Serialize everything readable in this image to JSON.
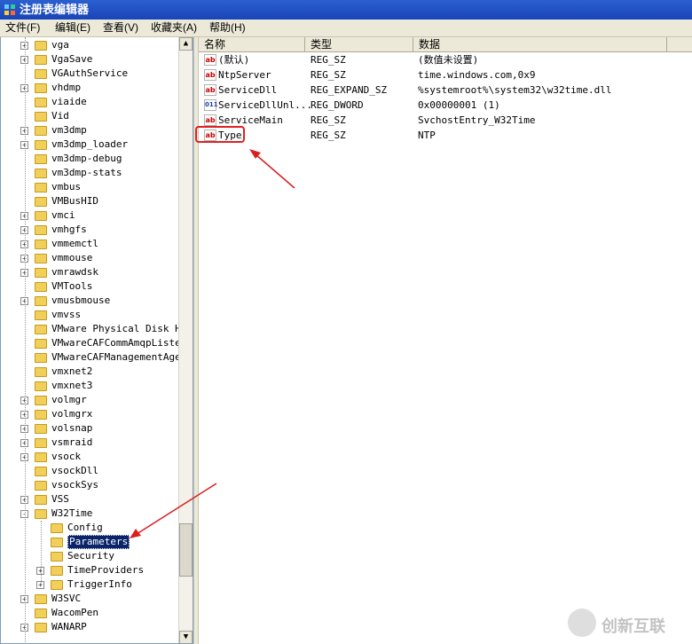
{
  "window": {
    "title": "注册表编辑器"
  },
  "menu": [
    "文件(F)",
    "编辑(E)",
    "查看(V)",
    "收藏夹(A)",
    "帮助(H)"
  ],
  "tree": {
    "items": [
      {
        "label": "vga",
        "exp": "+",
        "level": 0
      },
      {
        "label": "VgaSave",
        "exp": "+",
        "level": 0
      },
      {
        "label": "VGAuthService",
        "exp": "",
        "level": 0
      },
      {
        "label": "vhdmp",
        "exp": "+",
        "level": 0
      },
      {
        "label": "viaide",
        "exp": "",
        "level": 0
      },
      {
        "label": "Vid",
        "exp": "",
        "level": 0
      },
      {
        "label": "vm3dmp",
        "exp": "+",
        "level": 0
      },
      {
        "label": "vm3dmp_loader",
        "exp": "+",
        "level": 0
      },
      {
        "label": "vm3dmp-debug",
        "exp": "",
        "level": 0
      },
      {
        "label": "vm3dmp-stats",
        "exp": "",
        "level": 0
      },
      {
        "label": "vmbus",
        "exp": "",
        "level": 0
      },
      {
        "label": "VMBusHID",
        "exp": "",
        "level": 0
      },
      {
        "label": "vmci",
        "exp": "+",
        "level": 0
      },
      {
        "label": "vmhgfs",
        "exp": "+",
        "level": 0
      },
      {
        "label": "vmmemctl",
        "exp": "+",
        "level": 0
      },
      {
        "label": "vmmouse",
        "exp": "+",
        "level": 0
      },
      {
        "label": "vmrawdsk",
        "exp": "+",
        "level": 0
      },
      {
        "label": "VMTools",
        "exp": "",
        "level": 0
      },
      {
        "label": "vmusbmouse",
        "exp": "+",
        "level": 0
      },
      {
        "label": "vmvss",
        "exp": "",
        "level": 0
      },
      {
        "label": "VMware Physical Disk Hel",
        "exp": "",
        "level": 0
      },
      {
        "label": "VMwareCAFCommAmqpListene",
        "exp": "",
        "level": 0
      },
      {
        "label": "VMwareCAFManagementAgent",
        "exp": "",
        "level": 0
      },
      {
        "label": "vmxnet2",
        "exp": "",
        "level": 0
      },
      {
        "label": "vmxnet3",
        "exp": "",
        "level": 0
      },
      {
        "label": "volmgr",
        "exp": "+",
        "level": 0
      },
      {
        "label": "volmgrx",
        "exp": "+",
        "level": 0
      },
      {
        "label": "volsnap",
        "exp": "+",
        "level": 0
      },
      {
        "label": "vsmraid",
        "exp": "+",
        "level": 0
      },
      {
        "label": "vsock",
        "exp": "+",
        "level": 0
      },
      {
        "label": "vsockDll",
        "exp": "",
        "level": 0
      },
      {
        "label": "vsockSys",
        "exp": "",
        "level": 0
      },
      {
        "label": "VSS",
        "exp": "+",
        "level": 0
      },
      {
        "label": "W32Time",
        "exp": "-",
        "level": 0
      },
      {
        "label": "Config",
        "exp": "",
        "level": 1
      },
      {
        "label": "Parameters",
        "exp": "",
        "level": 1,
        "selected": true
      },
      {
        "label": "Security",
        "exp": "",
        "level": 1
      },
      {
        "label": "TimeProviders",
        "exp": "+",
        "level": 1
      },
      {
        "label": "TriggerInfo",
        "exp": "+",
        "level": 1
      },
      {
        "label": "W3SVC",
        "exp": "+",
        "level": 0
      },
      {
        "label": "WacomPen",
        "exp": "",
        "level": 0
      },
      {
        "label": "WANARP",
        "exp": "+",
        "level": 0
      }
    ]
  },
  "columns": {
    "name": "名称",
    "type": "类型",
    "data": "数据"
  },
  "values": [
    {
      "icon": "ab",
      "name": "(默认)",
      "type": "REG_SZ",
      "data": "(数值未设置)"
    },
    {
      "icon": "ab",
      "name": "NtpServer",
      "type": "REG_SZ",
      "data": "time.windows.com,0x9"
    },
    {
      "icon": "ab",
      "name": "ServiceDll",
      "type": "REG_EXPAND_SZ",
      "data": "%systemroot%\\system32\\w32time.dll"
    },
    {
      "icon": "bin",
      "name": "ServiceDllUnl...",
      "type": "REG_DWORD",
      "data": "0x00000001 (1)"
    },
    {
      "icon": "ab",
      "name": "ServiceMain",
      "type": "REG_SZ",
      "data": "SvchostEntry_W32Time"
    },
    {
      "icon": "ab",
      "name": "Type",
      "type": "REG_SZ",
      "data": "NTP"
    }
  ],
  "watermark": {
    "text": "创新互联"
  },
  "colors": {
    "accent": "#e02020",
    "selection": "#0a246a",
    "titlebar": "#1f50c4"
  }
}
